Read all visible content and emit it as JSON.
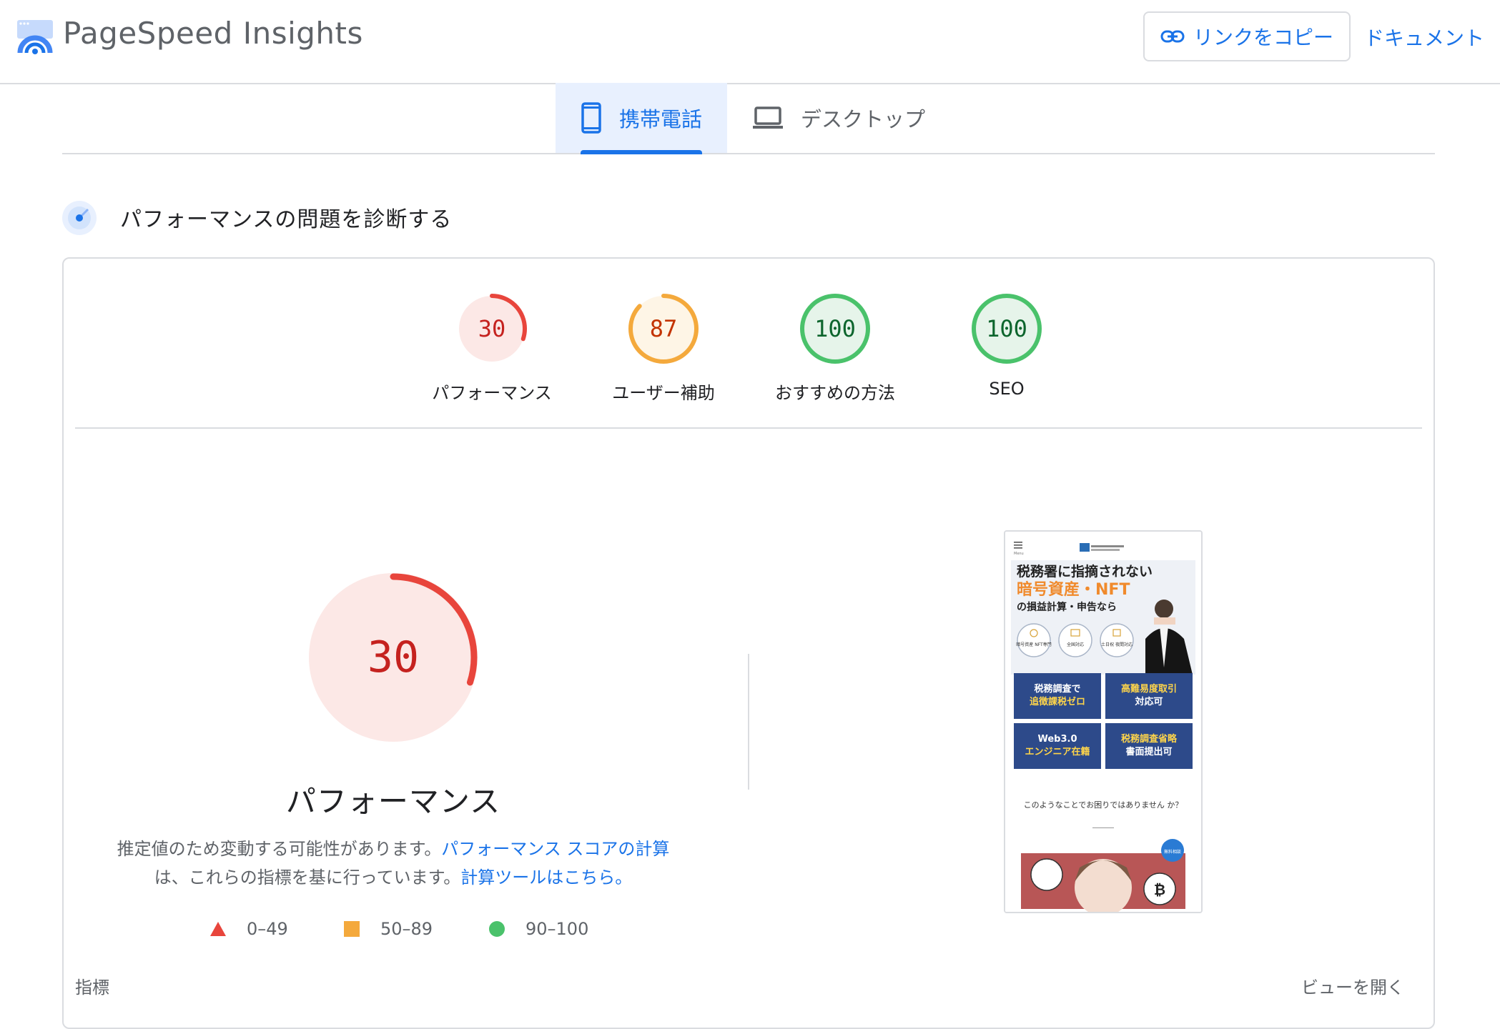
{
  "header": {
    "app_title": "PageSpeed Insights",
    "copy_link_label": "リンクをコピー",
    "docs_label": "ドキュメント"
  },
  "tabs": [
    {
      "label": "携帯電話",
      "selected": true,
      "icon": "smartphone-icon"
    },
    {
      "label": "デスクトップ",
      "selected": false,
      "icon": "laptop-icon"
    }
  ],
  "section": {
    "title": "パフォーマンスの問題を診断する"
  },
  "scores": [
    {
      "label": "パフォーマンス",
      "value": "30",
      "status": "fail"
    },
    {
      "label": "ユーザー補助",
      "value": "87",
      "status": "average"
    },
    {
      "label": "おすすめの方法",
      "value": "100",
      "status": "pass"
    },
    {
      "label": "SEO",
      "value": "100",
      "status": "pass"
    }
  ],
  "detail": {
    "score": "30",
    "title": "パフォーマンス",
    "desc_part1": "推定値のため変動する可能性があります。",
    "desc_link1": "パフォーマンス スコアの計算",
    "desc_part2": "は、これらの指標を基に行っています。",
    "desc_link2": "計算ツールはこちら。"
  },
  "legend": [
    {
      "range": "0–49",
      "shape": "triangle",
      "color": "#e8453c"
    },
    {
      "range": "50–89",
      "shape": "square",
      "color": "#f4a93c"
    },
    {
      "range": "90–100",
      "shape": "circle",
      "color": "#4ac26b"
    }
  ],
  "footer": {
    "metrics_label": "指標",
    "expand_label": "ビューを開く"
  },
  "screenshot": {
    "menu_label": "Menu",
    "headline1": "税務署に指摘されない",
    "headline2": "暗号資産・NFT",
    "headline3": "の損益計算・申告なら",
    "badge1": "暗号資産 NFT専門",
    "badge2": "全国対応",
    "badge3": "土日祝 夜間対応",
    "tile1a": "税務調査で",
    "tile1b": "追徴課税ゼロ",
    "tile2a": "高難易度取引",
    "tile2b": "対応可",
    "tile3a": "Web3.0",
    "tile3b": "エンジニア在籍",
    "tile4a": "税務調査省略",
    "tile4b": "書面提出可",
    "question": "このようなことでお困りではありません か？",
    "fab": "無料相談"
  },
  "colors": {
    "accent": "#1a73e8",
    "fail": "#c5221f",
    "fail_arc": "#e8453c",
    "average": "#c33300",
    "average_arc": "#f4a93c",
    "pass": "#0d652d",
    "pass_arc": "#4ac26b"
  }
}
